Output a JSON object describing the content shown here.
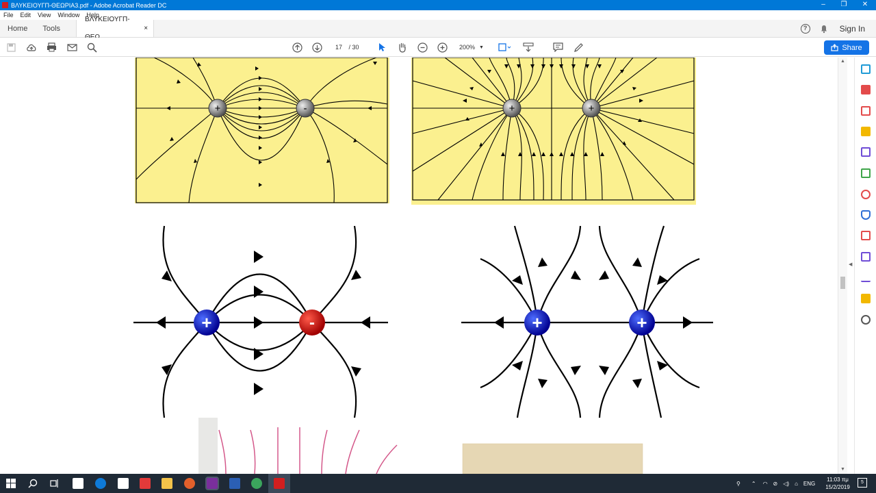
{
  "window": {
    "title": "ΒΛΥΚΕΙΟΥΓΠ-ΘΕΩΡΙΑ3.pdf - Adobe Acrobat Reader DC",
    "minimize": "–",
    "maximize": "❐",
    "close": "✕"
  },
  "menu": [
    "File",
    "Edit",
    "View",
    "Window",
    "Help"
  ],
  "tabs": {
    "home": "Home",
    "tools": "Tools",
    "doc": "ΒΛΥΚΕΙΟΥΓΠ-ΘΕΩ...",
    "close": "×"
  },
  "header_right": {
    "help": "?",
    "sign_in": "Sign In"
  },
  "toolbar": {
    "current_page": "17",
    "total_pages": "/ 30",
    "zoom": "200%",
    "share": "Share"
  },
  "figures": {
    "charge_plus": "+",
    "charge_minus": "-",
    "field_color_top": "#fbf08f",
    "positive_color": "#0000c8",
    "negative_color": "#cc0000",
    "magnet_line_color": "#d4588a"
  },
  "taskbar": {
    "lang": "ENG",
    "time": "11:03 πμ",
    "date": "15/2/2019",
    "notif_count": "5"
  },
  "colors": {
    "accent": "#1473e6",
    "titlebar": "#0078d7",
    "taskbar": "#1f2a36"
  }
}
